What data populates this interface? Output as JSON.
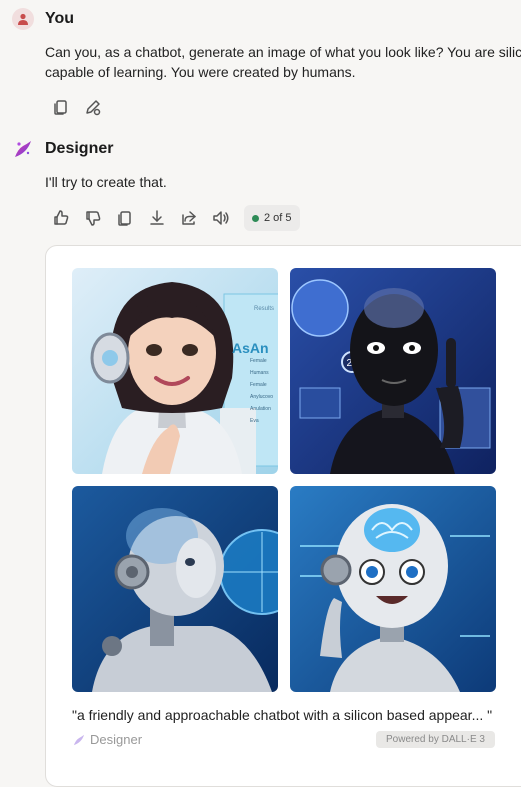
{
  "user_message": {
    "author": "You",
    "text_lines": [
      "Can you, as a chatbot, generate an image of what you look like? You are silico",
      "capable of learning. You were created by humans."
    ],
    "actions": [
      "copy-icon",
      "edit-icon"
    ]
  },
  "bot_message": {
    "author": "Designer",
    "text": "I'll try to create that.",
    "actions": [
      "thumbs-up-icon",
      "thumbs-down-icon",
      "copy-icon",
      "download-icon",
      "share-icon",
      "speaker-icon"
    ],
    "counter": "2 of 5"
  },
  "image_card": {
    "images": [
      {
        "name": "generated-image-1",
        "subject": "smiling android girl with headphones",
        "panel_title": "AsAn",
        "panel_top": "Results",
        "panel_items": [
          "Female",
          "Humans",
          "Female",
          "Anylucovo",
          "Anulation",
          "Eva"
        ]
      },
      {
        "name": "generated-image-2",
        "subject": "black robot raising finger",
        "badge": "20"
      },
      {
        "name": "generated-image-3",
        "subject": "silver robot profile with hologram globe"
      },
      {
        "name": "generated-image-4",
        "subject": "cartoon robot with visible brain"
      }
    ],
    "caption": "\"a friendly and approachable chatbot with a silicon based appear... \"",
    "footer_brand": "Designer",
    "powered_by": "Powered by DALL·E 3"
  },
  "colors": {
    "accent_green": "#2e8b57",
    "user_avatar_bg": "#f1dede",
    "designer_purple": "#7b3fe4"
  }
}
